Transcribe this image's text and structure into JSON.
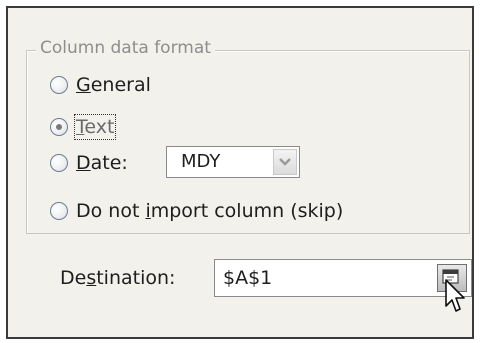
{
  "column_data_format": {
    "legend": "Column data format",
    "options": [
      {
        "mnemonic": "G",
        "rest": "eneral",
        "checked": false,
        "focused": false
      },
      {
        "mnemonic": "T",
        "rest": "ext",
        "checked": true,
        "focused": true
      },
      {
        "mnemonic": "D",
        "rest": "ate:",
        "checked": false,
        "focused": false
      },
      {
        "prefix": "Do not ",
        "mnemonic": "i",
        "rest": "mport column (skip)",
        "checked": false,
        "focused": false
      }
    ],
    "date_format": {
      "value": "MDY"
    }
  },
  "destination": {
    "label_prefix": "De",
    "label_mnemonic": "s",
    "label_rest": "tination:",
    "value": "$A$1"
  },
  "icons": {
    "combo_arrow": "chevron-down-icon",
    "collapse_dialog": "collapse-dialog-icon",
    "cursor": "mouse-pointer-icon"
  },
  "colors": {
    "panel_bg": "#f2f1ec",
    "legend_text": "#8e8e8e",
    "border": "#3a3a3a"
  }
}
